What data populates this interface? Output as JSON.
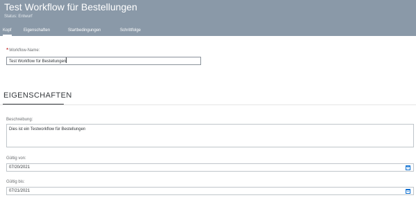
{
  "header": {
    "title": "Test Workflow für Bestellungen",
    "status": "Status: Entwurf"
  },
  "tabs": [
    {
      "label": "Kopf",
      "active": true
    },
    {
      "label": "Eigenschaften",
      "active": false
    },
    {
      "label": "Startbedingungen",
      "active": false
    },
    {
      "label": "Schrittfolge",
      "active": false
    }
  ],
  "form": {
    "workflow_name_label": "Workflow-Name:",
    "workflow_name_required": "*",
    "workflow_name_value": "Test Workflow für Bestellungen"
  },
  "section": {
    "title": "EIGENSCHAFTEN"
  },
  "description": {
    "label": "Beschreibung:",
    "value": "Dies ist ein Testworkflow für Bestellungen"
  },
  "valid_from": {
    "label": "Gültig von:",
    "value": "07/20/2021",
    "icon": "calendar-icon"
  },
  "valid_to": {
    "label": "Gültig bis:",
    "value": "07/21/2021",
    "icon": "calendar-icon"
  },
  "colors": {
    "header_bg": "#8a99a8",
    "accent": "#0a6ed1",
    "required": "#bb0000"
  }
}
